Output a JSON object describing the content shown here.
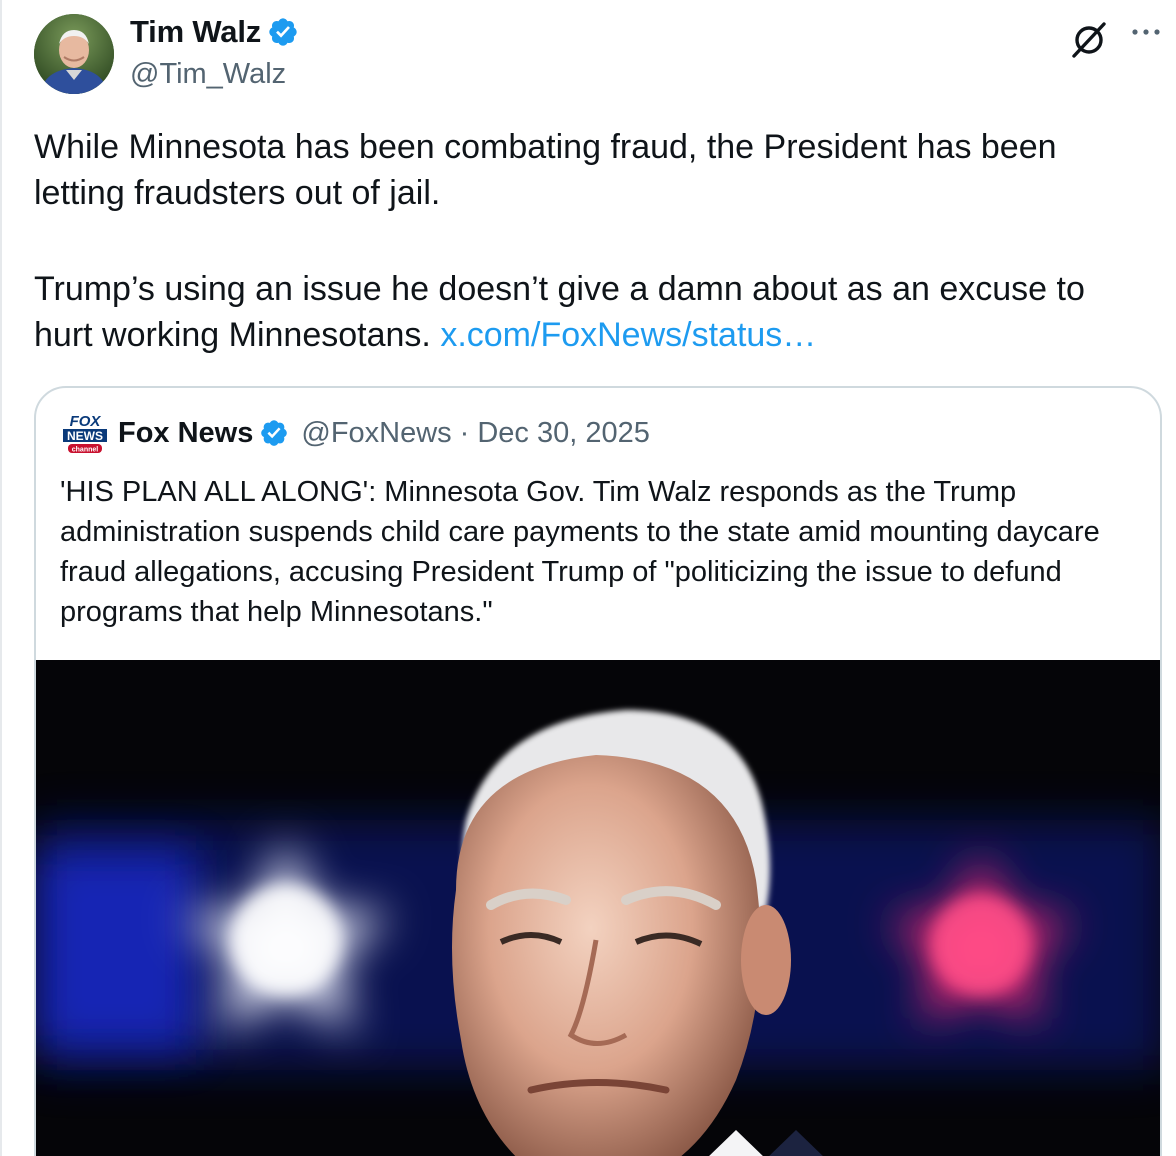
{
  "author": {
    "name": "Tim Walz",
    "handle": "@Tim_Walz",
    "verified_color": "#1d9bf0"
  },
  "tweet": {
    "paragraph1": "While Minnesota has been combating fraud, the President has been letting fraudsters out of jail.",
    "paragraph2": "Trump’s using an issue he doesn’t give a damn about as an excuse to hurt working Minnesotans.",
    "link_text": "x.com/FoxNews/status…"
  },
  "quoted": {
    "name": "Fox News",
    "handle": "@FoxNews",
    "separator": "·",
    "date": "Dec 30, 2025",
    "text": "'HIS PLAN ALL ALONG': Minnesota Gov. Tim Walz responds as the Trump administration suspends child care payments to the state amid mounting daycare fraud allegations, accusing President Trump of \"politicizing the issue to defund programs that help Minnesotans.\"",
    "logo_text_top": "FOX",
    "logo_text_mid": "NEWS",
    "logo_text_bot": "channel"
  },
  "colors": {
    "link": "#1d9bf0",
    "secondary_text": "#536471",
    "border": "#cfd9de"
  },
  "icons": {
    "grok": "grok-icon",
    "more": "more-options-icon",
    "verified": "verified-badge-icon"
  }
}
